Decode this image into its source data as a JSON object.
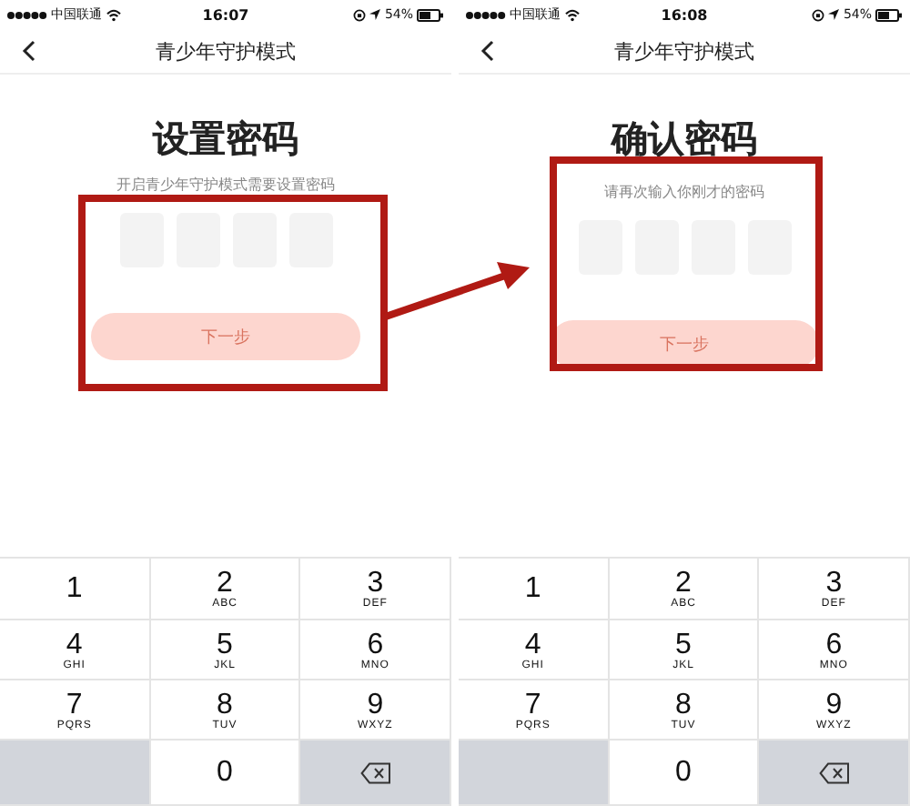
{
  "panels": [
    {
      "status": {
        "carrier": "中国联通",
        "time": "16:07",
        "battery": "54%"
      },
      "nav_title": "青少年守护模式",
      "heading": "设置密码",
      "hint": "开启青少年守护模式需要设置密码",
      "button": "下一步",
      "arrow": true,
      "keypad": [
        {
          "kind": "digit",
          "digit": "1"
        },
        {
          "kind": "digit",
          "digit": "2",
          "letters": "ABC"
        },
        {
          "kind": "digit",
          "digit": "3",
          "letters": "DEF"
        },
        {
          "kind": "digit",
          "digit": "4",
          "letters": "GHI"
        },
        {
          "kind": "digit",
          "digit": "5",
          "letters": "JKL"
        },
        {
          "kind": "digit",
          "digit": "6",
          "letters": "MNO"
        },
        {
          "kind": "digit",
          "digit": "7",
          "letters": "PQRS"
        },
        {
          "kind": "digit",
          "digit": "8",
          "letters": "TUV"
        },
        {
          "kind": "digit",
          "digit": "9",
          "letters": "WXYZ"
        },
        {
          "kind": "blank"
        },
        {
          "kind": "digit",
          "digit": "0"
        },
        {
          "kind": "delete"
        }
      ]
    },
    {
      "status": {
        "carrier": "中国联通",
        "time": "16:08",
        "battery": "54%"
      },
      "nav_title": "青少年守护模式",
      "heading": "确认密码",
      "hint": "请再次输入你刚才的密码",
      "button": "下一步",
      "arrow": false,
      "keypad": [
        {
          "kind": "digit",
          "digit": "1"
        },
        {
          "kind": "digit",
          "digit": "2",
          "letters": "ABC"
        },
        {
          "kind": "digit",
          "digit": "3",
          "letters": "DEF"
        },
        {
          "kind": "digit",
          "digit": "4",
          "letters": "GHI"
        },
        {
          "kind": "digit",
          "digit": "5",
          "letters": "JKL"
        },
        {
          "kind": "digit",
          "digit": "6",
          "letters": "MNO"
        },
        {
          "kind": "digit",
          "digit": "7",
          "letters": "PQRS"
        },
        {
          "kind": "digit",
          "digit": "8",
          "letters": "TUV"
        },
        {
          "kind": "digit",
          "digit": "9",
          "letters": "WXYZ"
        },
        {
          "kind": "blank"
        },
        {
          "kind": "digit",
          "digit": "0"
        },
        {
          "kind": "delete"
        }
      ]
    }
  ]
}
